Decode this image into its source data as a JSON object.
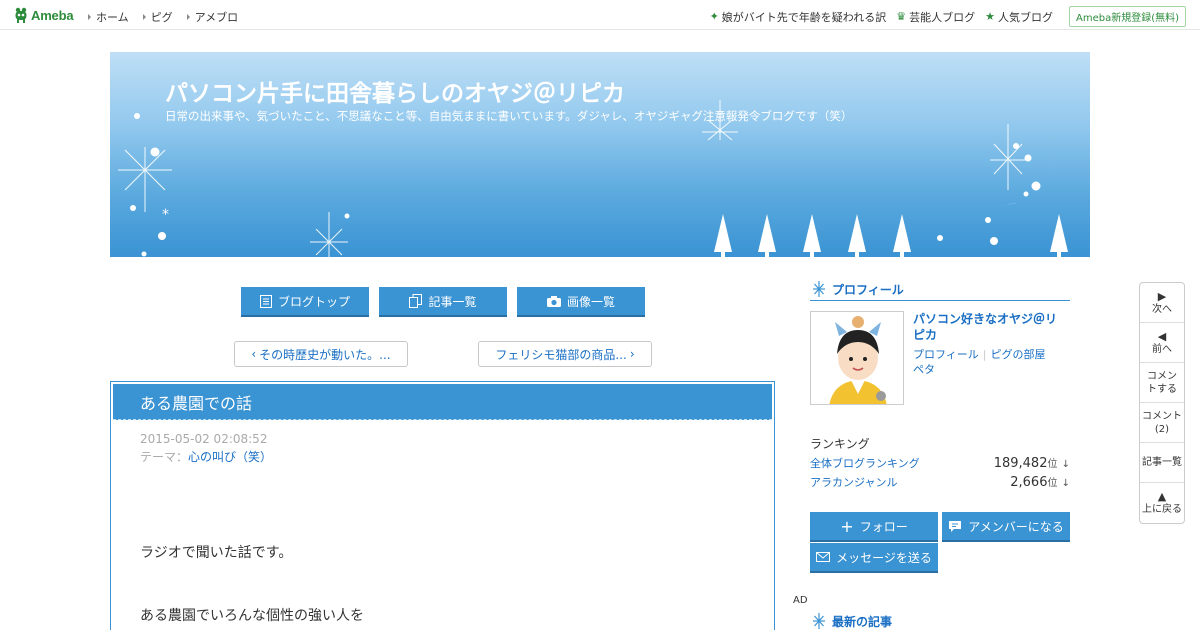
{
  "topbar": {
    "logo": "Ameba",
    "nav": [
      "ホーム",
      "ピグ",
      "アメブロ"
    ],
    "right_links": [
      {
        "icon": "sparkle-icon",
        "label": "娘がバイト先で年齢を疑われる訳"
      },
      {
        "icon": "crown-icon",
        "label": "芸能人ブログ"
      },
      {
        "icon": "star-icon",
        "label": "人気ブログ"
      }
    ],
    "register": "Ameba新規登録(無料)"
  },
  "banner": {
    "title": "パソコン片手に田舎暮らしのオヤジ＠リピカ",
    "description": "日常の出来事や、気づいたこと、不思議なこと等、自由気ままに書いています。ダジャレ、オヤジギャグ注意報発令ブログです（笑）"
  },
  "blog_menu": [
    "ブログトップ",
    "記事一覧",
    "画像一覧"
  ],
  "pager": {
    "prev": "その時歴史が動いた。...",
    "next": "フェリシモ猫部の商品..."
  },
  "article": {
    "title": "ある農園での話",
    "date": "2015-05-02 02:08:52",
    "theme_label": "テーマ：",
    "theme": "心の叫び（笑）",
    "lines": [
      "ラジオで聞いた話です。",
      "ある農園でいろんな個性の強い人を"
    ]
  },
  "sidebar": {
    "profile_heading": "プロフィール",
    "name": "パソコン好きなオヤジ＠リピカ",
    "links": [
      "プロフィール",
      "ピグの部屋",
      "ペタ"
    ],
    "ranking_title": "ランキング",
    "rankings": [
      {
        "label": "全体ブログランキング",
        "value": "189,482",
        "unit": "位",
        "trend": "↓"
      },
      {
        "label": "アラカンジャンル",
        "value": "2,666",
        "unit": "位",
        "trend": "↓"
      }
    ],
    "buttons": {
      "follow": "フォロー",
      "amember": "アメンバーになる",
      "message": "メッセージを送る"
    },
    "ad": "AD",
    "recent_heading": "最新の記事"
  },
  "floatnav": {
    "next": "次へ",
    "prev": "前へ",
    "comment": "コメントする",
    "comments": "コメント",
    "comments_count": "(2)",
    "list": "記事一覧",
    "top": "上に戻る"
  },
  "colors": {
    "accent": "#3a93d3",
    "link": "#1a6fc4",
    "brand": "#2d8c3c"
  }
}
